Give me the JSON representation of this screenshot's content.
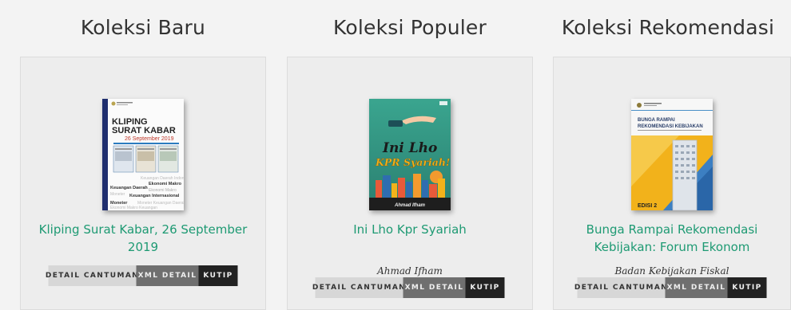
{
  "collections": [
    {
      "heading": "Koleksi Baru",
      "book": {
        "title": "Kliping Surat Kabar, 26 September 2019",
        "author": "",
        "cover": {
          "line1": "KLIPING",
          "line2": "SURAT KABAR",
          "date": "26 September 2019",
          "keywords": [
            "Keuangan Daerah",
            "Ekonomi Makro",
            "Keuangan Internasional",
            "Moneter"
          ]
        }
      },
      "buttons": {
        "detail": "DETAIL CANTUMAN",
        "xml": "XML DETAIL",
        "kutip": "KUTIP"
      }
    },
    {
      "heading": "Koleksi Populer",
      "book": {
        "title": "Ini Lho Kpr Syariah",
        "author": "Ahmad Ifham",
        "cover": {
          "line1": "Ini Lho",
          "line2": "KPR Syariah!",
          "author_strip": "Ahmad Ifham"
        }
      },
      "buttons": {
        "detail": "DETAIL CANTUMAN",
        "xml": "XML DETAIL",
        "kutip": "KUTIP"
      }
    },
    {
      "heading": "Koleksi Rekomendasi",
      "book": {
        "title": "Bunga Rampai Rekomendasi Kebijakan: Forum Ekonom",
        "author": "Badan Kebijakan Fiskal",
        "cover": {
          "line1": "BUNGA RAMPAI",
          "line2": "REKOMENDASI KEBIJAKAN",
          "edition": "EDISI 2"
        }
      },
      "buttons": {
        "detail": "DETAIL CANTUMAN",
        "xml": "XML DETAIL",
        "kutip": "KUTIP"
      }
    }
  ],
  "colors": {
    "title_link": "#1e9a73",
    "btn_detail": "#d7d7d7",
    "btn_xml": "#6f6f6f",
    "btn_kutip": "#222222"
  }
}
